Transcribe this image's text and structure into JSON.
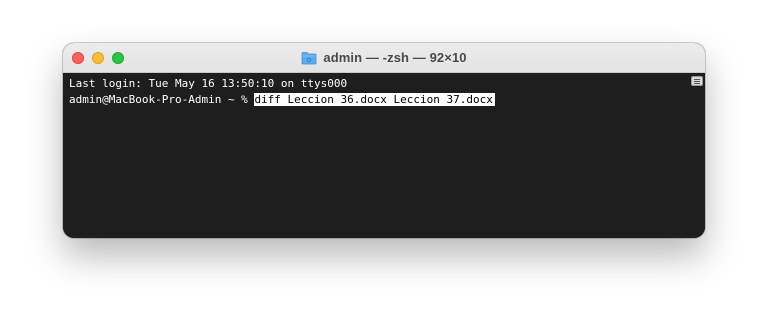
{
  "window": {
    "title": "admin — -zsh — 92×10",
    "folder_icon": "folder-icon"
  },
  "terminal": {
    "last_login": "Last login: Tue May 16 13:50:10 on ttys000",
    "prompt": "admin@MacBook-Pro-Admin ~ % ",
    "command": "diff Leccion 36.docx Leccion 37.docx"
  },
  "colors": {
    "terminal_bg": "#1e1e1e",
    "terminal_fg": "#ffffff",
    "close": "#fe5f57",
    "minimize": "#febc2e",
    "zoom": "#28c840",
    "folder_blue": "#5aaaf0"
  }
}
